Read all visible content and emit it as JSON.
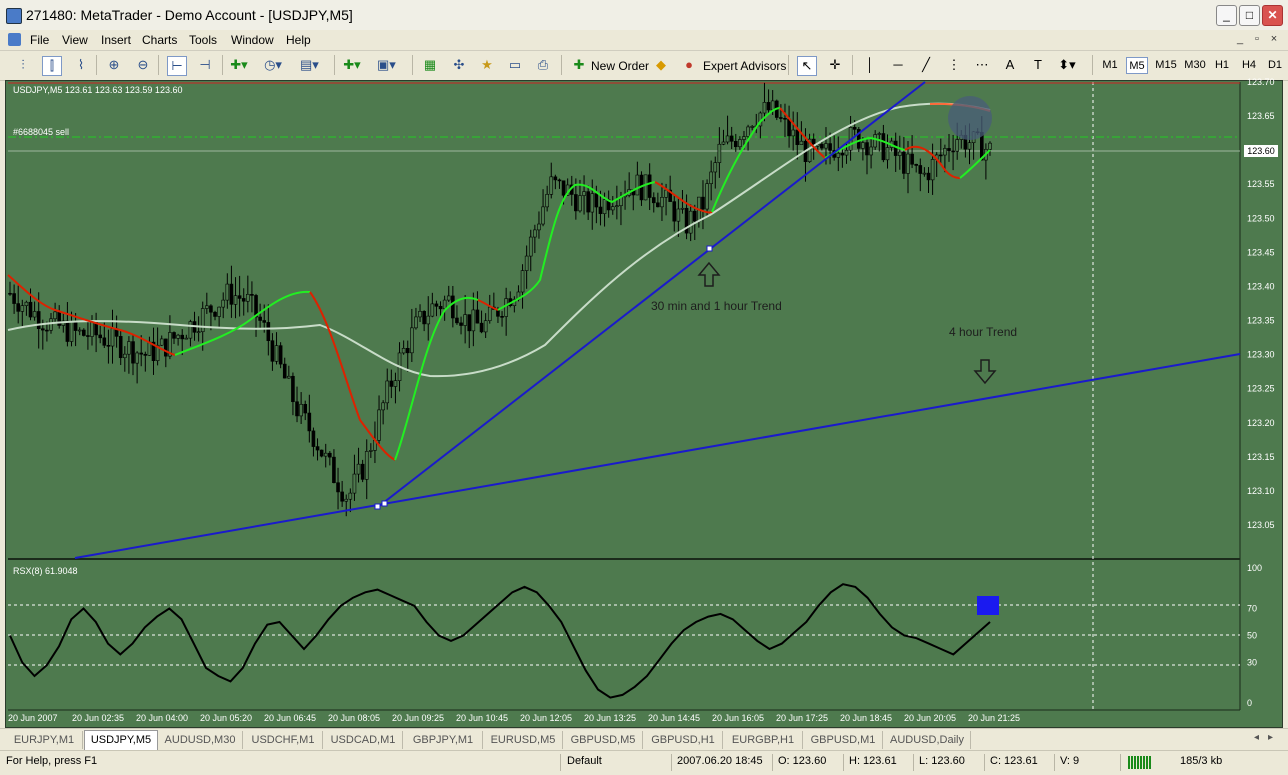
{
  "window": {
    "title": "271480: MetaTrader - Demo Account - [USDJPY,M5]",
    "minimize": "_",
    "maximize": "□",
    "close": "✕"
  },
  "menu": {
    "items": [
      "File",
      "View",
      "Insert",
      "Charts",
      "Tools",
      "Window",
      "Help"
    ],
    "mdi": [
      "_",
      "▫",
      "×"
    ]
  },
  "toolbar": {
    "new_order": "New Order",
    "expert_advisors": "Expert Advisors",
    "timeframes": [
      "M1",
      "M5",
      "M15",
      "M30",
      "H1",
      "H4",
      "D1"
    ],
    "active_timeframe": "M5",
    "icons": [
      "bar-chart-icon",
      "candlestick-icon",
      "line-chart-icon",
      "zoom-in-icon",
      "zoom-out-icon",
      "chart-shift-icon",
      "autoscroll-icon",
      "indicators-icon",
      "periods-icon",
      "templates-icon",
      "new-chart-icon",
      "profiles-icon",
      "market-watch-icon",
      "navigator-icon",
      "favorites-icon",
      "terminal-icon",
      "print-preview-icon",
      "cursor-icon",
      "crosshair-icon",
      "vertical-line-icon",
      "horizontal-line-icon",
      "trendline-icon",
      "gann-icon",
      "fibonacci-icon",
      "text-icon",
      "label-icon",
      "arrows-icon"
    ]
  },
  "chart": {
    "header": "USDJPY,M5  123.61 123.63 123.59 123.60",
    "order_label": "#6688045 sell",
    "current_price": "123.60",
    "annotation_1": "30 min and 1 hour Trend",
    "annotation_2": "4 hour Trend",
    "colors": {
      "background": "#4e7a4e",
      "trendline": "#1a1acc",
      "ma_up": "#22ee22",
      "ma_down": "#dd2200",
      "ma_slow": "#c8dcc8",
      "candles": "#000000",
      "order_line": "#22cc22"
    }
  },
  "chart_data": [
    {
      "type": "candlestick",
      "title": "USDJPY,M5",
      "ylim": [
        123.0,
        123.7
      ],
      "y_ticks": [
        "123.70",
        "123.65",
        "123.60",
        "123.55",
        "123.50",
        "123.45",
        "123.40",
        "123.35",
        "123.30",
        "123.25",
        "123.20",
        "123.15",
        "123.10",
        "123.05"
      ],
      "x_ticks": [
        "20 Jun 2007",
        "20 Jun 02:35",
        "20 Jun 04:00",
        "20 Jun 05:20",
        "20 Jun 06:45",
        "20 Jun 08:05",
        "20 Jun 09:25",
        "20 Jun 10:45",
        "20 Jun 12:05",
        "20 Jun 13:25",
        "20 Jun 14:45",
        "20 Jun 16:05",
        "20 Jun 17:25",
        "20 Jun 18:45",
        "20 Jun 20:05",
        "20 Jun 21:25"
      ],
      "close_series": [
        123.39,
        123.37,
        123.35,
        123.34,
        123.33,
        123.33,
        123.32,
        123.31,
        123.3,
        123.31,
        123.33,
        123.35,
        123.37,
        123.39,
        123.38,
        123.34,
        123.28,
        123.22,
        123.18,
        123.13,
        123.09,
        123.14,
        123.22,
        123.29,
        123.34,
        123.37,
        123.38,
        123.35,
        123.34,
        123.37,
        123.4,
        123.48,
        123.55,
        123.54,
        123.52,
        123.52,
        123.54,
        123.55,
        123.54,
        123.52,
        123.49,
        123.52,
        123.6,
        123.62,
        123.65,
        123.66,
        123.63,
        123.6,
        123.59,
        123.61,
        123.62,
        123.61,
        123.6,
        123.58,
        123.56,
        123.59,
        123.62,
        123.61,
        123.6
      ]
    },
    {
      "type": "line",
      "title": "RSX(8) 61.9048",
      "ylim": [
        0,
        100
      ],
      "y_ticks": [
        "100",
        "70",
        "50",
        "30",
        "0"
      ],
      "levels": [
        70,
        50,
        30
      ],
      "values": [
        50,
        30,
        20,
        28,
        42,
        62,
        70,
        60,
        44,
        36,
        44,
        56,
        64,
        70,
        62,
        44,
        26,
        20,
        16,
        26,
        44,
        58,
        60,
        50,
        40,
        50,
        62,
        72,
        78,
        82,
        84,
        80,
        76,
        72,
        60,
        50,
        46,
        50,
        58,
        66,
        74,
        82,
        86,
        82,
        72,
        60,
        42,
        24,
        10,
        4,
        6,
        12,
        20,
        32,
        44,
        54,
        60,
        64,
        66,
        62,
        54,
        46,
        40,
        44,
        52,
        60,
        72,
        82,
        88,
        86,
        78,
        66,
        56,
        50,
        48,
        44,
        40,
        36,
        44,
        52,
        60
      ]
    }
  ],
  "tabs": [
    "EURJPY,M1",
    "USDJPY,M5",
    "AUDUSD,M30",
    "USDCHF,M1",
    "USDCAD,M1",
    "GBPJPY,M1",
    "EURUSD,M5",
    "GBPUSD,M5",
    "GBPUSD,H1",
    "EURGBP,H1",
    "GBPUSD,M1",
    "AUDUSD,Daily"
  ],
  "active_tab": "USDJPY,M5",
  "tab_scroll": [
    "◂",
    "▸"
  ],
  "status": {
    "help": "For Help, press F1",
    "profile": "Default",
    "datetime": "2007.06.20 18:45",
    "open": "O: 123.60",
    "high": "H: 123.61",
    "low": "L: 123.60",
    "close": "C: 123.61",
    "volume": "V: 9",
    "traffic": "185/3 kb"
  }
}
